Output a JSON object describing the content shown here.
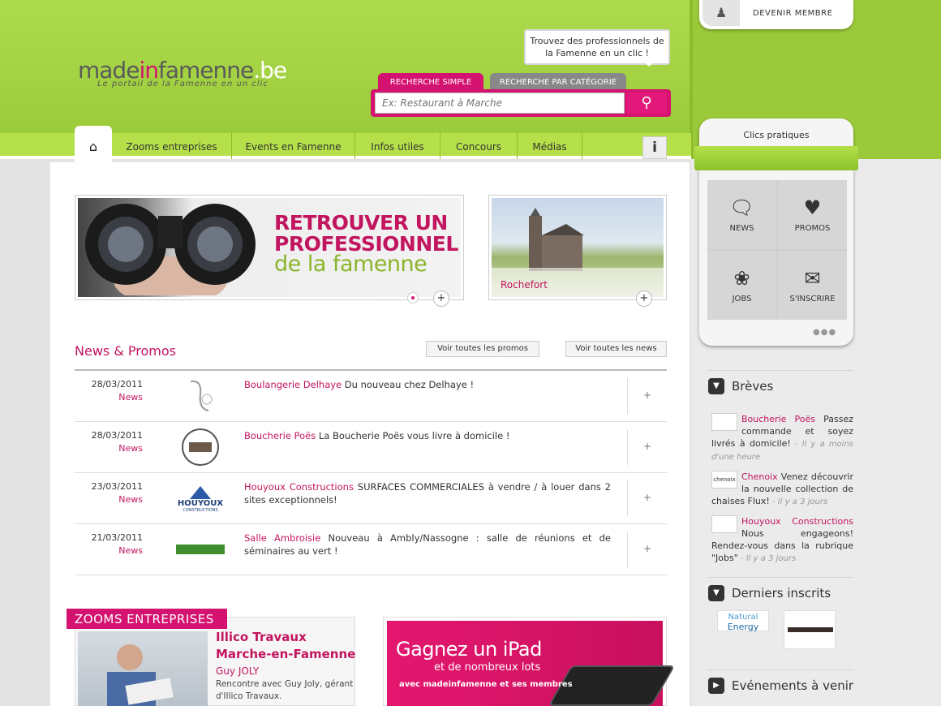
{
  "header": {
    "logo": {
      "part1": "made",
      "part2": "in",
      "part3": "famenne",
      "part4": ".be"
    },
    "tagline": "Le portail de la Famenne en un clic",
    "tooltip": "Trouvez des professionnels de la Famenne en un clic !",
    "search_tabs": [
      "RECHERCHE SIMPLE",
      "RECHERCHE PAR CATÉGORIE"
    ],
    "search_placeholder": "Ex: Restaurant à Marche",
    "member_label": "DEVENIR MEMBRE"
  },
  "nav": {
    "items": [
      "Zooms entreprises",
      "Events en Famenne",
      "Infos utiles",
      "Concours",
      "Médias"
    ],
    "info_label": "i"
  },
  "banners": {
    "main": {
      "line1": "RETROUVER UN",
      "line2": "PROFESSIONNEL",
      "line3": "de la famenne"
    },
    "side": {
      "caption": "Rochefort"
    }
  },
  "news": {
    "title": "News & Promos",
    "btn_promos": "Voir toutes les promos",
    "btn_news": "Voir toutes les news",
    "rows": [
      {
        "date": "28/03/2011",
        "cat": "News",
        "company": "Boulangerie Delhaye",
        "text": " Du nouveau chez Delhaye !"
      },
      {
        "date": "28/03/2011",
        "cat": "News",
        "company": "Boucherie Poës",
        "text": " La Boucherie Poës vous livre à domicile !"
      },
      {
        "date": "23/03/2011",
        "cat": "News",
        "company": "Houyoux Constructions",
        "text": " SURFACES COMMERCIALES à vendre / à louer dans 2 sites exceptionnels!"
      },
      {
        "date": "21/03/2011",
        "cat": "News",
        "company": "Salle Ambroisie",
        "text": " Nouveau à Ambly/Nassogne : salle de réunions et de séminaires au vert !"
      }
    ],
    "logos": {
      "houyoux1": "HOUYOUX",
      "houyoux2": "CONSTRUCTIONS"
    }
  },
  "zoom": {
    "tag": "ZOOMS ENTREPRISES",
    "title1": "Illico Travaux",
    "title2": "Marche-en-Famenne",
    "author": "Guy JOLY",
    "desc": "Rencontre avec Guy Joly, gérant d'Illico Travaux."
  },
  "ipad": {
    "t1": "Gagnez un iPad",
    "t2": "et de nombreux lots",
    "t3": "avec madeinfamenne et ses membres"
  },
  "sidebar": {
    "clics_title": "Clics pratiques",
    "clics": [
      "NEWS",
      "PROMOS",
      "JOBS",
      "S'INSCRIRE"
    ],
    "breves_title": "Brèves",
    "breves": [
      {
        "company": "Boucherie Poës",
        "text": " Passez commande et soyez livrés à domicile!",
        "time": " - Il y a moins d'une heure",
        "thumb": ""
      },
      {
        "company": "Chenoix",
        "text": " Venez découvrir la nouvelle collection de chaises Flux!",
        "time": " - Il y a 3 jours",
        "thumb": "chenoix"
      },
      {
        "company": "Houyoux Constructions",
        "text": " Nous engageons! Rendez-vous dans la rubrique \"Jobs\"",
        "time": " - Il y a 3 jours",
        "thumb": ""
      }
    ],
    "inscrits_title": "Derniers inscrits",
    "inscrit1": {
      "line1": "Natural",
      "line2": "Energy"
    },
    "events_title": "Evénements à venir"
  },
  "colors": {
    "green": "#aedb4e",
    "pink": "#d4126f"
  }
}
